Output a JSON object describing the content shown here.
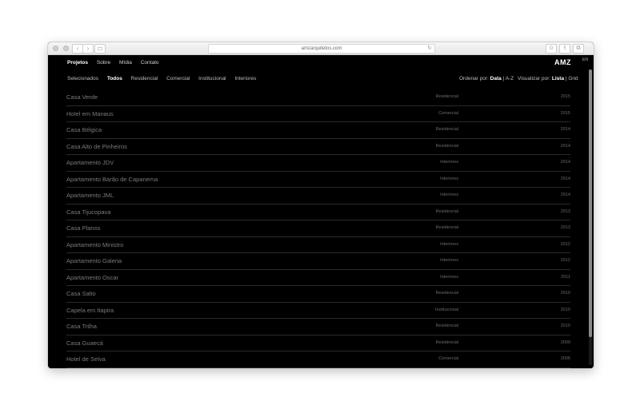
{
  "browser": {
    "url": "amzarquitetos.com",
    "back": "‹",
    "forward": "›",
    "sidebar": "▭",
    "reload": "↻",
    "share": "⇪",
    "tabs": "⧉",
    "downloads": "⊙"
  },
  "nav": {
    "items": [
      "Projetos",
      "Sobre",
      "Mídia",
      "Contato"
    ],
    "logo": "AMZ",
    "lang": "EN"
  },
  "filters": {
    "items": [
      "Selecionados",
      "Todos",
      "Residencial",
      "Comercial",
      "Institucional",
      "Interiores"
    ],
    "sort_label": "Ordenar por:",
    "sort_active": "Data",
    "sort_alt": "| A-Z",
    "view_label": "Visualizar por:",
    "view_active": "Lista",
    "view_alt": "| Grid"
  },
  "projects": [
    {
      "name": "Casa Verde",
      "category": "Residencial",
      "year": "2015"
    },
    {
      "name": "Hotel em Manaus",
      "category": "Comercial",
      "year": "2015"
    },
    {
      "name": "Casa Bélgica",
      "category": "Residencial",
      "year": "2014"
    },
    {
      "name": "Casa Alto de Pinheiros",
      "category": "Residencial",
      "year": "2014"
    },
    {
      "name": "Apartamento JDV",
      "category": "Interiores",
      "year": "2014"
    },
    {
      "name": "Apartamento Barão de Capanema",
      "category": "Interiores",
      "year": "2014"
    },
    {
      "name": "Apartamento JML",
      "category": "Interiores",
      "year": "2014"
    },
    {
      "name": "Casa Tijucopava",
      "category": "Residencial",
      "year": "2013"
    },
    {
      "name": "Casa Planos",
      "category": "Residencial",
      "year": "2013"
    },
    {
      "name": "Apartamento Ministro",
      "category": "Interiores",
      "year": "2012"
    },
    {
      "name": "Apartamento Galeria",
      "category": "Interiores",
      "year": "2012"
    },
    {
      "name": "Apartamento Oscar",
      "category": "Interiores",
      "year": "2011"
    },
    {
      "name": "Casa Salto",
      "category": "Residencial",
      "year": "2010"
    },
    {
      "name": "Capela em Itapira",
      "category": "Institucional",
      "year": "2010"
    },
    {
      "name": "Casa Trilha",
      "category": "Residencial",
      "year": "2010"
    },
    {
      "name": "Casa Guaecá",
      "category": "Residencial",
      "year": "2009"
    },
    {
      "name": "Hotel de Selva",
      "category": "Comercial",
      "year": "2006"
    }
  ]
}
